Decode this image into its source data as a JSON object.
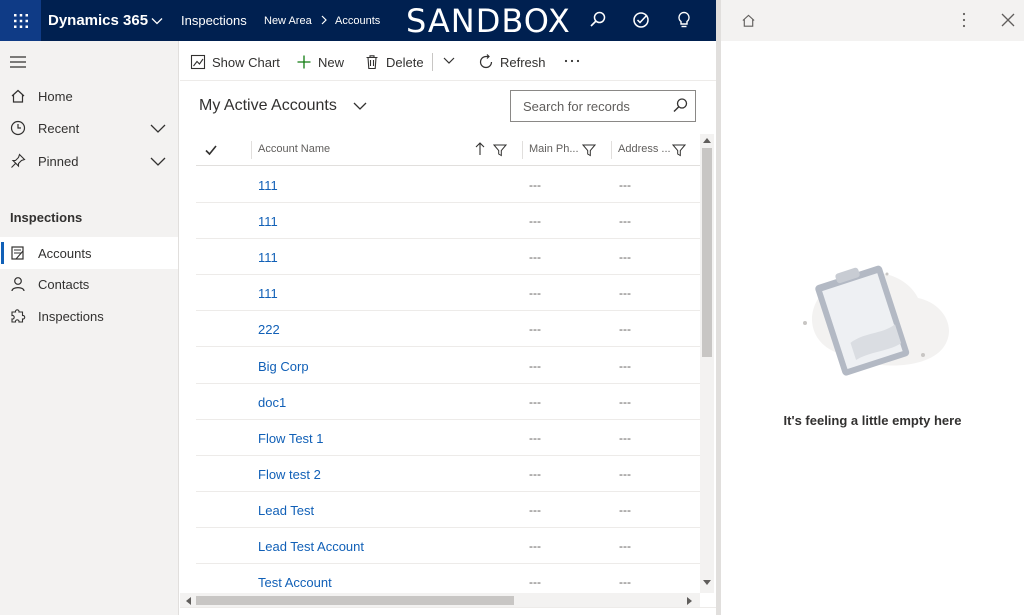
{
  "topbar": {
    "app_name": "Dynamics 365",
    "area_name": "Inspections",
    "breadcrumb": [
      "New Area",
      "Accounts"
    ],
    "environment_label": "SANDBOX",
    "icons": [
      "search-icon",
      "task-icon",
      "lightbulb-icon"
    ]
  },
  "nav": {
    "home": "Home",
    "recent": "Recent",
    "pinned": "Pinned",
    "section_title": "Inspections",
    "items": [
      "Accounts",
      "Contacts",
      "Inspections"
    ],
    "selected": "Accounts"
  },
  "commands": {
    "show_chart": "Show Chart",
    "new": "New",
    "delete": "Delete",
    "refresh": "Refresh"
  },
  "view": {
    "title": "My Active Accounts",
    "search_placeholder": "Search for records"
  },
  "grid": {
    "columns": [
      "Account Name",
      "Main Ph...",
      "Address ..."
    ],
    "sort_column": "Account Name",
    "rows": [
      {
        "name": "111",
        "phone": "---",
        "address": "---"
      },
      {
        "name": "111",
        "phone": "---",
        "address": "---"
      },
      {
        "name": "111",
        "phone": "---",
        "address": "---"
      },
      {
        "name": "111",
        "phone": "---",
        "address": "---"
      },
      {
        "name": "222",
        "phone": "---",
        "address": "---"
      },
      {
        "name": "Big Corp",
        "phone": "---",
        "address": "---"
      },
      {
        "name": "doc1",
        "phone": "---",
        "address": "---"
      },
      {
        "name": "Flow Test 1",
        "phone": "---",
        "address": "---"
      },
      {
        "name": "Flow test 2",
        "phone": "---",
        "address": "---"
      },
      {
        "name": "Lead Test",
        "phone": "---",
        "address": "---"
      },
      {
        "name": "Lead Test Account",
        "phone": "---",
        "address": "---"
      },
      {
        "name": "Test Account",
        "phone": "---",
        "address": "---"
      }
    ]
  },
  "side_panel": {
    "empty_message": "It's feeling a little empty here"
  },
  "colors": {
    "topbar": "#002050",
    "waffle": "#0f3b86",
    "link": "#1160b7",
    "nav_bg": "#f3f2f1"
  }
}
